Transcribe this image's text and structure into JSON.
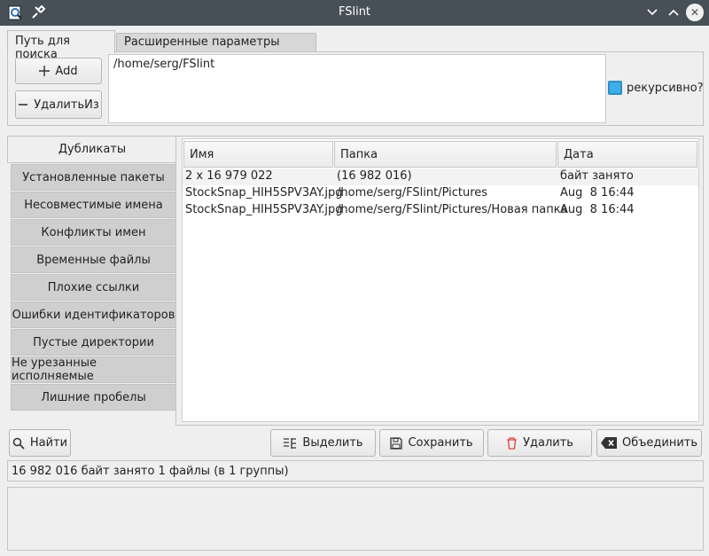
{
  "window": {
    "title": "FSlint"
  },
  "tabs": [
    {
      "label": "Путь для поиска",
      "active": true
    },
    {
      "label": "Расширенные параметры поиска",
      "active": false
    }
  ],
  "search": {
    "add_label": "Add",
    "remove_label": "УдалитьИз",
    "paths": [
      "/home/serg/FSlint"
    ],
    "recursive_label": "рекурсивно?",
    "recursive_checked": true
  },
  "sidebar": {
    "items": [
      {
        "label": "Дубликаты",
        "active": true
      },
      {
        "label": "Установленные пакеты"
      },
      {
        "label": "Несовместимые имена"
      },
      {
        "label": "Конфликты имен"
      },
      {
        "label": "Временные файлы"
      },
      {
        "label": "Плохие ссылки"
      },
      {
        "label": "Ошибки идентификаторов"
      },
      {
        "label": "Пустые директории"
      },
      {
        "label": "Не урезанные исполняемые"
      },
      {
        "label": "Лишние пробелы"
      }
    ]
  },
  "results": {
    "columns": [
      "Имя",
      "Папка",
      "Дата"
    ],
    "rows": [
      {
        "name": "2 x 16 979 022",
        "folder": "(16 982 016)",
        "date": "байт занято",
        "group": true
      },
      {
        "name": "StockSnap_HIH5SPV3AY.jpg",
        "folder": "/home/serg/FSlint/Pictures",
        "date": "Aug  8 16:44",
        "group": false
      },
      {
        "name": "StockSnap_HIH5SPV3AY.jpg",
        "folder": "/home/serg/FSlint/Pictures/Новая папка",
        "date": "Aug  8 16:44",
        "group": false
      }
    ]
  },
  "actions": {
    "find_label": "Найти",
    "select_label": "Выделить",
    "save_label": "Сохранить",
    "delete_label": "Удалить",
    "merge_label": "Объединить"
  },
  "status": {
    "text": "16 982 016 байт занято 1 файлы (в 1 группы)"
  },
  "colors": {
    "titlebar": "#475057",
    "accent": "#3daee9",
    "delete_icon": "#d9453c"
  },
  "icons": [
    "app-icon",
    "pin-icon",
    "minimize-icon",
    "maximize-icon",
    "close-icon",
    "plus-icon",
    "minus-icon",
    "search-icon",
    "select-icon",
    "save-icon",
    "trash-icon",
    "clear-icon"
  ]
}
